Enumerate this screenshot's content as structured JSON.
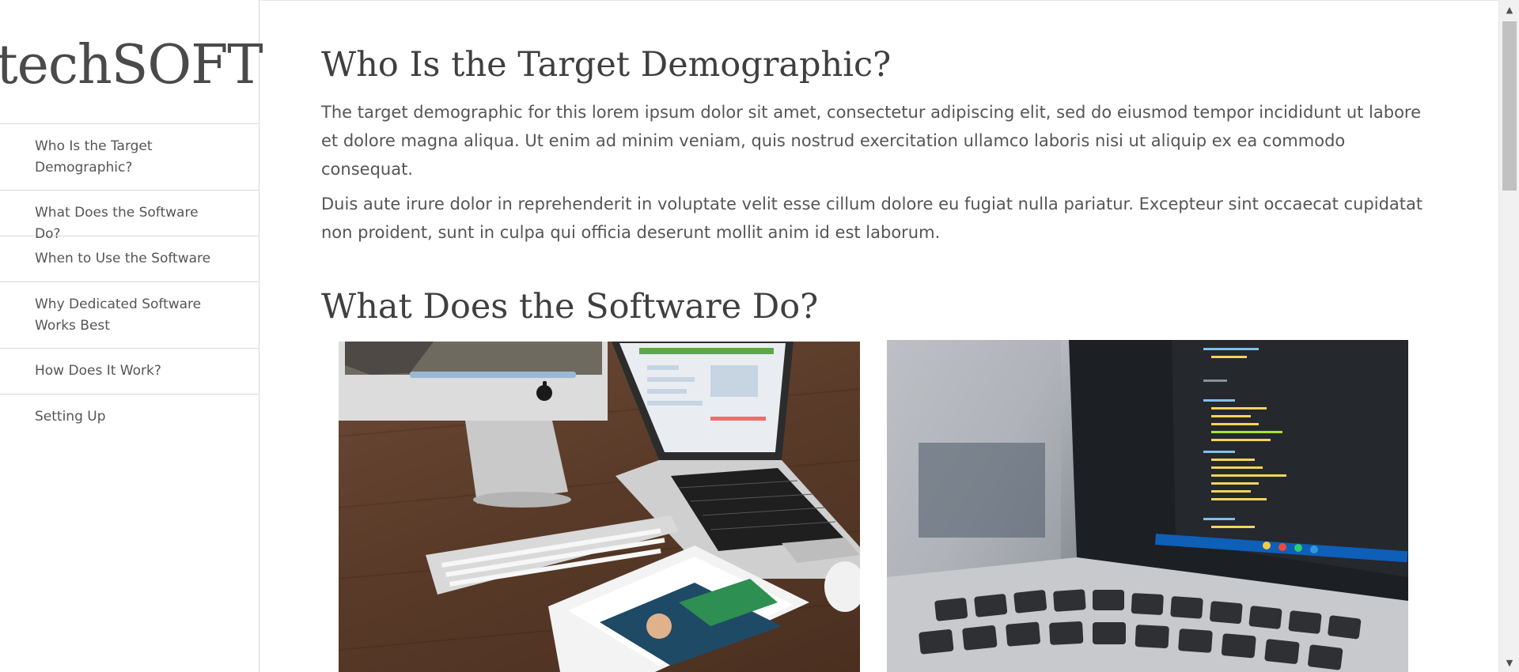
{
  "sidebar": {
    "brand": "techSOFT",
    "items": [
      {
        "label": "Who Is the Target Demographic?"
      },
      {
        "label": "What Does the Software Do?"
      },
      {
        "label": "When to Use the Software"
      },
      {
        "label": "Why Dedicated Software Works Best"
      },
      {
        "label": "How Does It Work?"
      },
      {
        "label": "Setting Up"
      }
    ]
  },
  "main": {
    "sections": [
      {
        "heading": "Who Is the Target Demographic?",
        "paragraphs": [
          "The target demographic for this lorem ipsum dolor sit amet, consectetur adipiscing elit, sed do eiusmod tempor incididunt ut labore et dolore magna aliqua. Ut enim ad minim veniam, quis nostrud exercitation ullamco laboris nisi ut aliquip ex ea commodo consequat.",
          "Duis aute irure dolor in reprehenderit in voluptate velit esse cillum dolore eu fugiat nulla pariatur. Excepteur sint occaecat cupidatat non proident, sunt in culpa qui officia deserunt mollit anim id est laborum."
        ]
      },
      {
        "heading": "What Does the Software Do?",
        "images": [
          {
            "icon": "desk-devices-photo"
          },
          {
            "icon": "code-laptop-photo"
          }
        ]
      }
    ]
  },
  "scrollbar": {
    "up_icon": "▲",
    "down_icon": "▼"
  },
  "colors": {
    "text": "#555555",
    "heading": "#3f3f3f",
    "border": "#d8d8d8",
    "background": "#ffffff"
  }
}
